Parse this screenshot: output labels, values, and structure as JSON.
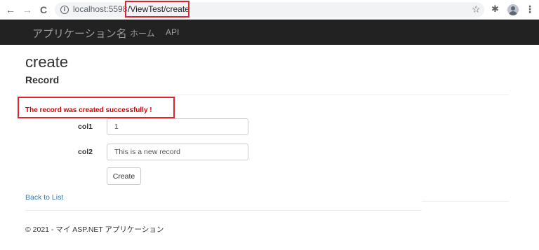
{
  "browser": {
    "back_glyph": "←",
    "forward_glyph": "→",
    "reload_glyph": "C",
    "url_host": "localhost:5598",
    "url_path": "/ViewTest/create",
    "star_glyph": "☆",
    "extensions_glyph": "✱",
    "menu_glyph": "⋮"
  },
  "navbar": {
    "brand": "アプリケーション名",
    "links": [
      "ホーム",
      "API"
    ]
  },
  "page": {
    "title": "create",
    "subtitle": "Record",
    "message": "The record was created successfully !",
    "fields": [
      {
        "label": "col1",
        "value": "1"
      },
      {
        "label": "col2",
        "value": "This is a new record"
      }
    ],
    "submit_label": "Create",
    "back_link": "Back to List",
    "footer": "© 2021 - マイ ASP.NET アプリケーション"
  },
  "colors": {
    "highlight": "#e0242f",
    "message": "#e00000",
    "navbar_bg": "#222222",
    "link": "#337ab7"
  }
}
